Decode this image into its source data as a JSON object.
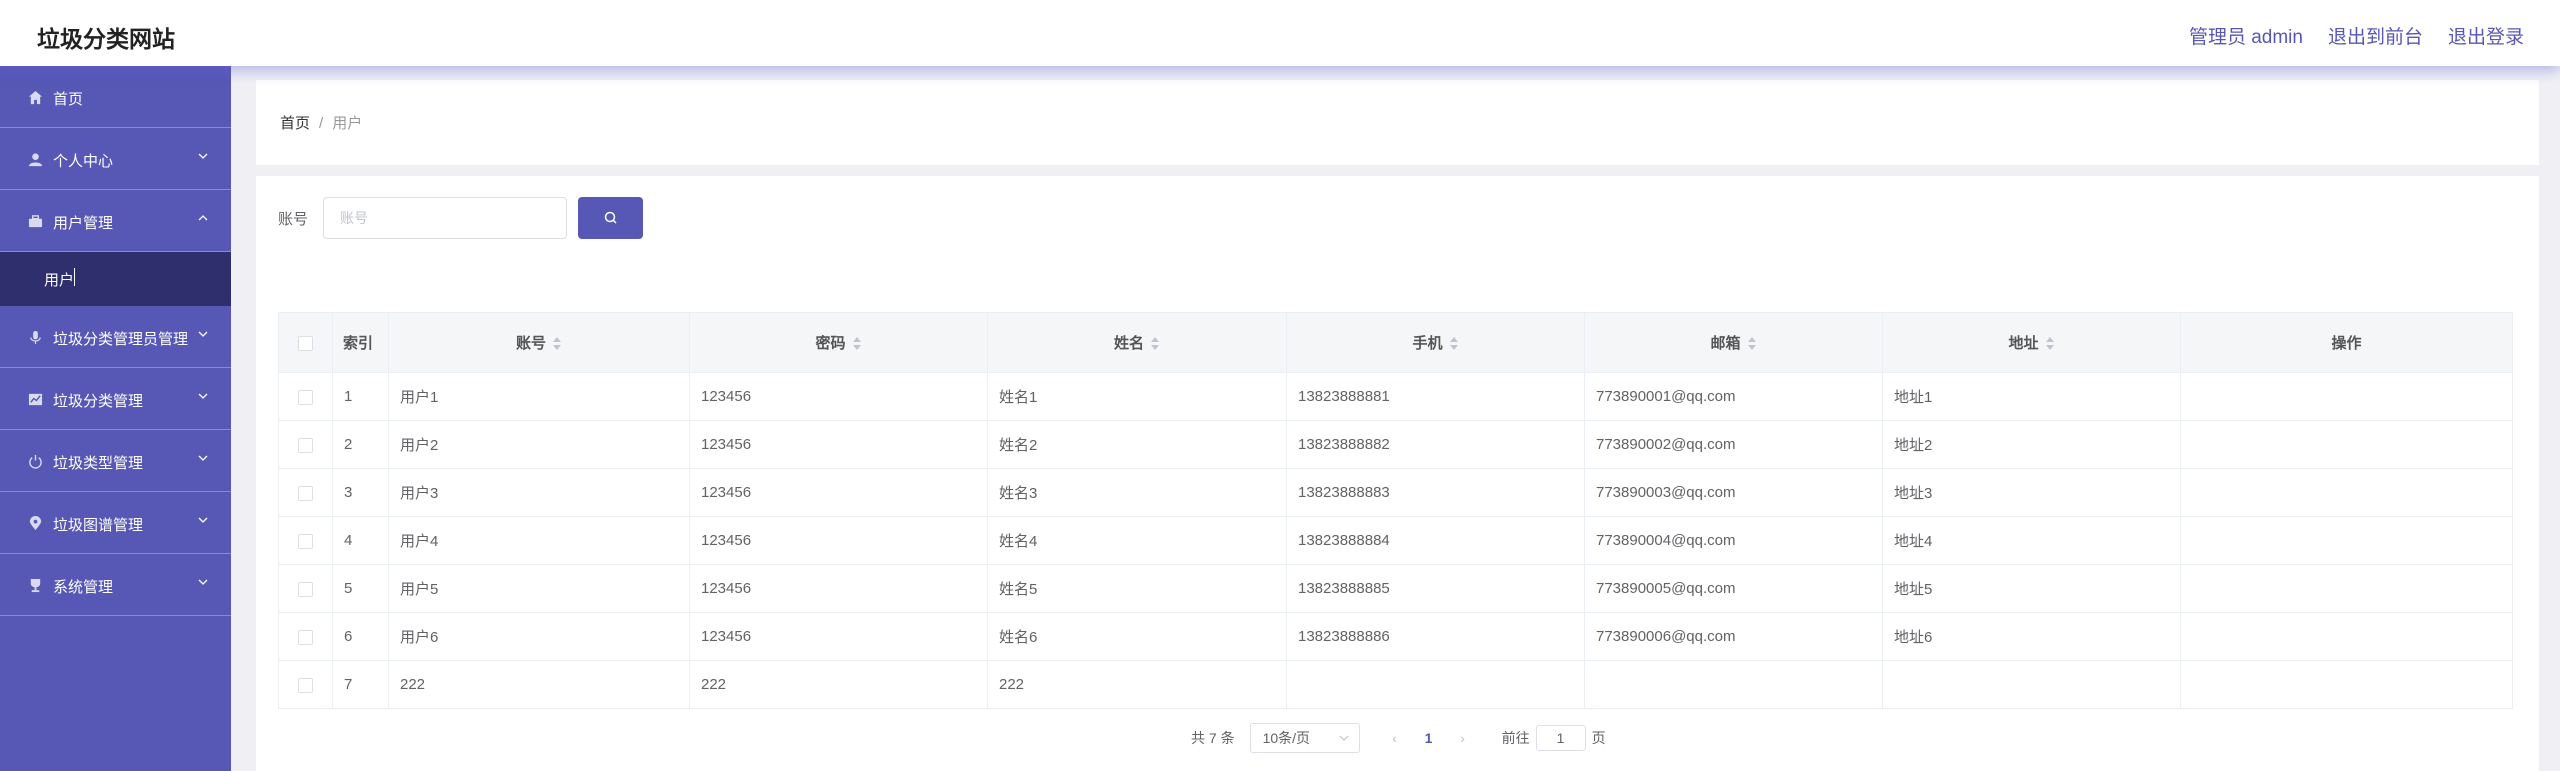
{
  "header": {
    "title": "垃圾分类网站",
    "admin_label": "管理员 admin",
    "frontend_link": "退出到前台",
    "logout_link": "退出登录"
  },
  "sidebar": {
    "items": [
      {
        "label": "首页",
        "icon": "home-icon"
      },
      {
        "label": "个人中心",
        "icon": "user-icon"
      },
      {
        "label": "用户管理",
        "icon": "briefcase-icon",
        "expanded": true
      },
      {
        "label": "用户",
        "sub": true,
        "cursor": "text-cursor"
      },
      {
        "label": "垃圾分类管理员管理",
        "icon": "microphone-icon"
      },
      {
        "label": "垃圾分类管理",
        "icon": "chart-icon"
      },
      {
        "label": "垃圾类型管理",
        "icon": "power-icon"
      },
      {
        "label": "垃圾图谱管理",
        "icon": "location-icon"
      },
      {
        "label": "系统管理",
        "icon": "trophy-icon"
      }
    ]
  },
  "breadcrumb": {
    "home": "首页",
    "separator": "/",
    "current": "用户"
  },
  "search": {
    "label": "账号",
    "placeholder": "账号"
  },
  "table": {
    "columns": [
      "索引",
      "账号",
      "密码",
      "姓名",
      "手机",
      "邮箱",
      "地址",
      "操作"
    ],
    "sortable": [
      false,
      true,
      true,
      true,
      true,
      true,
      true,
      false
    ],
    "rows": [
      [
        "1",
        "用户1",
        "123456",
        "姓名1",
        "13823888881",
        "773890001@qq.com",
        "地址1",
        ""
      ],
      [
        "2",
        "用户2",
        "123456",
        "姓名2",
        "13823888882",
        "773890002@qq.com",
        "地址2",
        ""
      ],
      [
        "3",
        "用户3",
        "123456",
        "姓名3",
        "13823888883",
        "773890003@qq.com",
        "地址3",
        ""
      ],
      [
        "4",
        "用户4",
        "123456",
        "姓名4",
        "13823888884",
        "773890004@qq.com",
        "地址4",
        ""
      ],
      [
        "5",
        "用户5",
        "123456",
        "姓名5",
        "13823888885",
        "773890005@qq.com",
        "地址5",
        ""
      ],
      [
        "6",
        "用户6",
        "123456",
        "姓名6",
        "13823888886",
        "773890006@qq.com",
        "地址6",
        ""
      ],
      [
        "7",
        "222",
        "222",
        "222",
        "",
        "",
        "",
        ""
      ]
    ]
  },
  "pagination": {
    "total": "共 7 条",
    "page_size": "10条/页",
    "current_page": "1",
    "goto_label": "前往",
    "goto_value": "1",
    "page_suffix": "页"
  },
  "colors": {
    "accent": "#5757b5",
    "submenu_active": "#2f2f6e"
  }
}
